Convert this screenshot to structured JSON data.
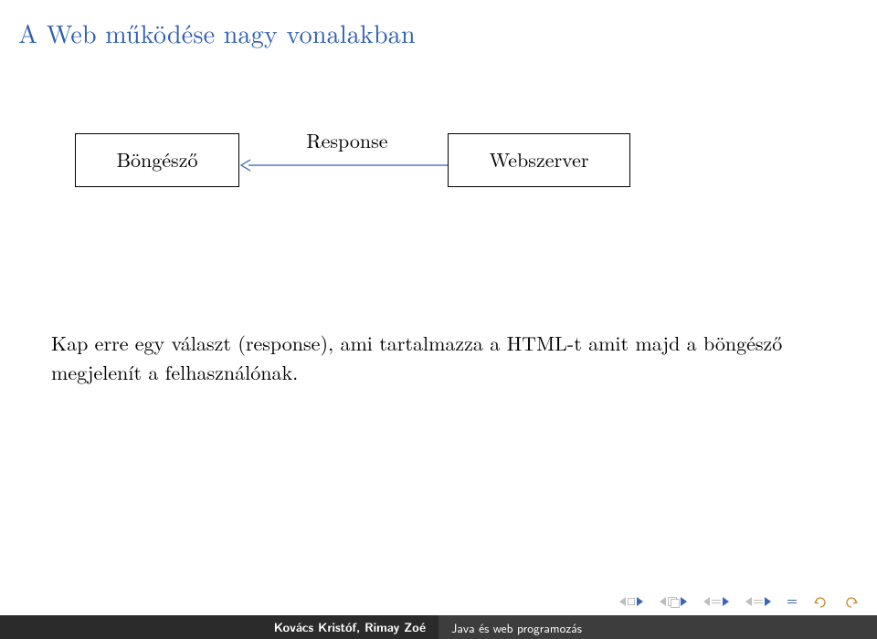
{
  "title": "A Web működése nagy vonalakban",
  "diagram": {
    "left_node": "Böngésző",
    "right_node": "Webszerver",
    "arrow_label": "Response"
  },
  "body": "Kap erre egy választ (response), ami tartalmazza a HTML-t amit majd a böngésző megjelenít a felhasználónak.",
  "footer": {
    "authors": "Kovács Kristóf, Rimay Zoé",
    "talk_title": "Java és web programozás"
  }
}
